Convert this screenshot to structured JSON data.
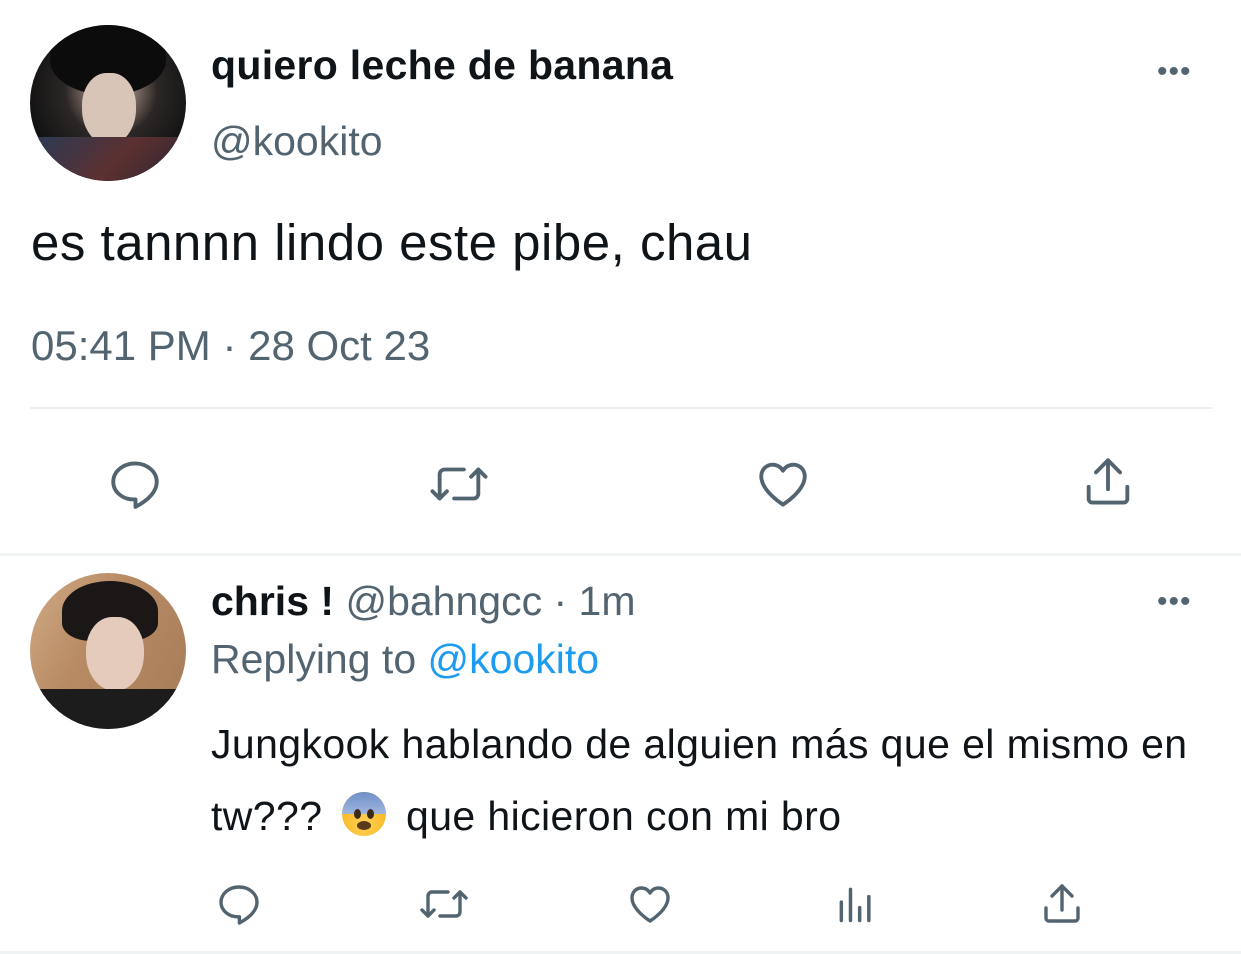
{
  "main_tweet": {
    "display_name": "quiero leche de banana",
    "handle": "@kookito",
    "text": "es tannnn lindo este pibe, chau",
    "timestamp": "05:41 PM · 28 Oct 23",
    "more_label": "•••",
    "actions": [
      {
        "icon": "reply-icon"
      },
      {
        "icon": "retweet-icon"
      },
      {
        "icon": "like-icon"
      },
      {
        "icon": "share-icon"
      }
    ]
  },
  "reply_tweet": {
    "display_name": "chris !",
    "handle": "@bahngcc",
    "separator": " · ",
    "time_ago": "1m",
    "replying_prefix": "Replying to",
    "replying_handle": "@kookito",
    "text_part1": "Jungkook hablando de alguien más que el mismo en tw???",
    "emoji": "anxious-face-emoji",
    "text_part2": "que hicieron con mi bro",
    "more_label": "•••",
    "actions": [
      {
        "icon": "reply-icon"
      },
      {
        "icon": "retweet-icon"
      },
      {
        "icon": "like-icon"
      },
      {
        "icon": "analytics-icon"
      },
      {
        "icon": "share-icon"
      }
    ]
  },
  "colors": {
    "text": "#0f1419",
    "secondary": "#536471",
    "link": "#1d9bf0",
    "divider": "#eff3f4"
  }
}
